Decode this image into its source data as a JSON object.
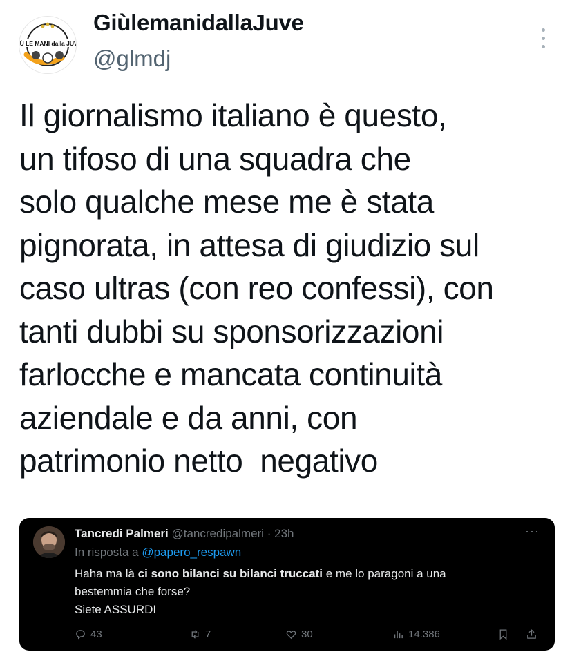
{
  "tweet": {
    "display_name": "GiùlemanidallaJuve",
    "handle": "@glmdj",
    "avatar_icon": "glmdj-logo-avatar",
    "avatar_logo_text": "GIÙ LE MANI dalla JUVE",
    "text_lines": [
      "Il giornalismo italiano è questo,",
      "un tifoso di una squadra che",
      "solo qualche mese me è stata",
      "pignorata, in attesa di giudizio sul",
      "caso ultras (con reo confessi), con",
      "tanti dubbi su sponsorizzazioni",
      "farlocche e mancata continuità",
      "aziendale e da anni, con",
      "patrimonio netto  negativo"
    ],
    "more_icon": "vertical-ellipsis-icon"
  },
  "quoted_tweet": {
    "display_name": "Tancredi Palmeri",
    "handle": "@tancredipalmeri",
    "separator": "·",
    "time": "23h",
    "reply_prefix": "In risposta a",
    "reply_to": "@papero_respawn",
    "body": {
      "line1_pre": "Haha ma là ",
      "line1_bold": "ci sono bilanci su bilanci truccati",
      "line1_post": " e me lo paragoni a una",
      "line2": "bestemmia che forse?",
      "line3": "Siete ASSURDI"
    },
    "more_label": "···",
    "actions": {
      "replies": "43",
      "retweets": "7",
      "likes": "30",
      "views": "14.386"
    },
    "background": "#000000",
    "link_color": "#1d9bf0"
  },
  "colors": {
    "text": "#0f1419",
    "secondary": "#536471",
    "background": "#ffffff"
  }
}
